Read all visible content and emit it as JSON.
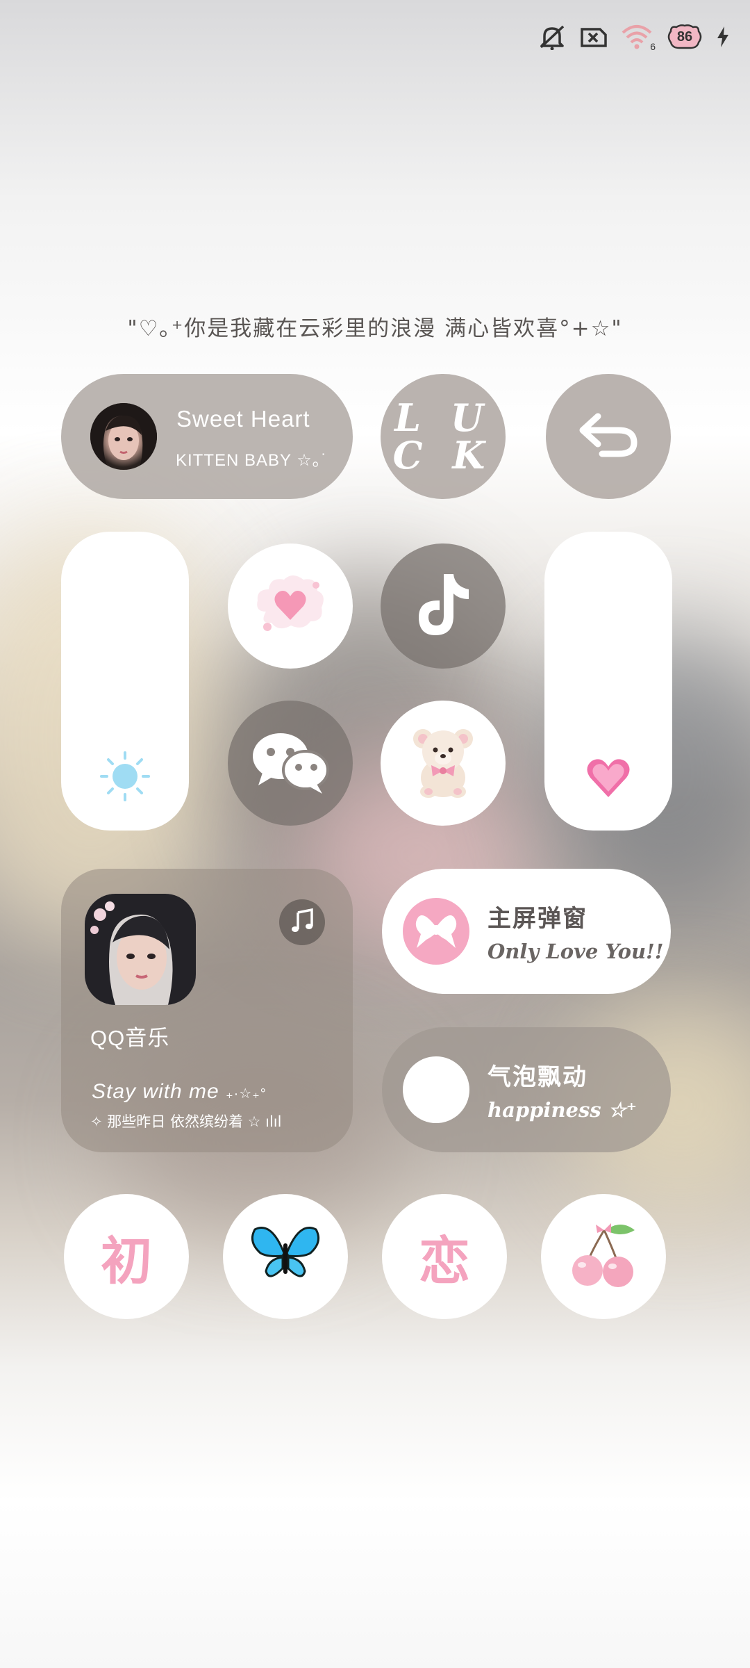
{
  "status_bar": {
    "icons": [
      "mute-icon",
      "sim-off-icon",
      "wifi-icon",
      "battery-icon",
      "charging-icon"
    ],
    "battery_level": "86",
    "wifi_label": "6"
  },
  "quote": "\"♡｡⁺你是我藏在云彩里的浪漫 满心皆欢喜°+☆\"",
  "profile_widget": {
    "title": "Sweet Heart",
    "subtitle": "KITTEN BABY ☆｡˙"
  },
  "luck_widget": {
    "line1": "L U",
    "line2": "C K"
  },
  "music_widget": {
    "app_name": "QQ音乐",
    "song": "Stay with me",
    "song_deco": "₊·☆₊°",
    "lyric": "✧ 那些昨日 依然缤纷着 ☆ ılıl"
  },
  "popup_widget": {
    "title": "主屏弹窗",
    "subtitle": "Only Love You!!"
  },
  "bubble_widget": {
    "title": "气泡飘动",
    "subtitle": "happiness ☆⁺"
  },
  "bottom_row": {
    "char1": "初",
    "char2": "恋"
  },
  "colors": {
    "accent_pink": "#f4a3be",
    "tile_gray": "#b2aba6",
    "sun_blue": "#8fd8f0",
    "butterfly_blue": "#2fb6f0"
  }
}
